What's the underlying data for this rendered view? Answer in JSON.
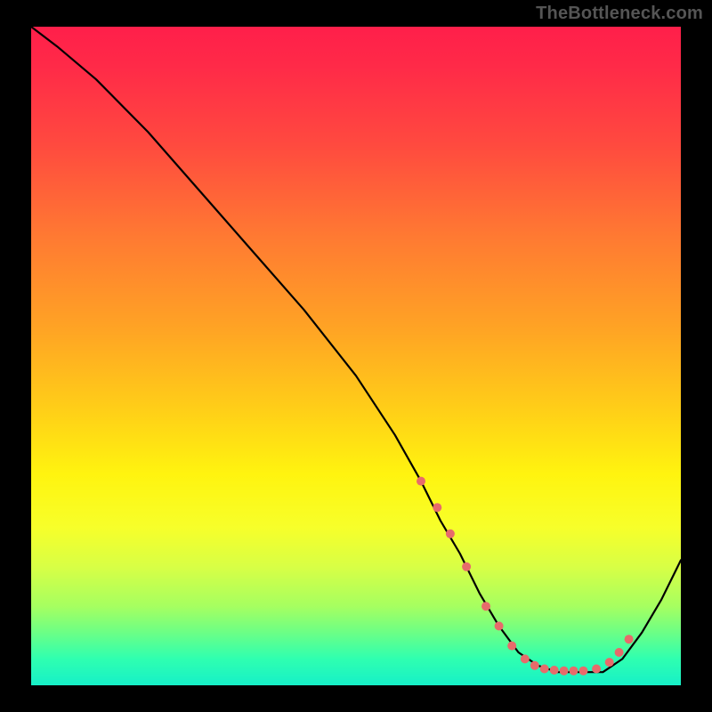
{
  "watermark": "TheBottleneck.com",
  "accent_color": "#e76b6b",
  "curve_color": "#000000",
  "chart_data": {
    "type": "line",
    "title": "",
    "xlabel": "",
    "ylabel": "",
    "xlim": [
      0,
      100
    ],
    "ylim": [
      0,
      100
    ],
    "x": [
      0,
      4,
      10,
      18,
      26,
      34,
      42,
      50,
      56,
      60,
      63,
      66,
      69,
      72,
      75,
      78,
      81,
      84,
      86,
      88,
      91,
      94,
      97,
      100
    ],
    "y": [
      100,
      97,
      92,
      84,
      75,
      66,
      57,
      47,
      38,
      31,
      25,
      20,
      14,
      9,
      5,
      3,
      2,
      2,
      2,
      2,
      4,
      8,
      13,
      19
    ],
    "markers": {
      "x": [
        60,
        62.5,
        64.5,
        67,
        70,
        72,
        74,
        76,
        77.5,
        79,
        80.5,
        82,
        83.5,
        85,
        87,
        89,
        90.5,
        92
      ],
      "y": [
        31,
        27,
        23,
        18,
        12,
        9,
        6,
        4,
        3,
        2.5,
        2.3,
        2.2,
        2.2,
        2.2,
        2.5,
        3.5,
        5,
        7
      ]
    }
  }
}
